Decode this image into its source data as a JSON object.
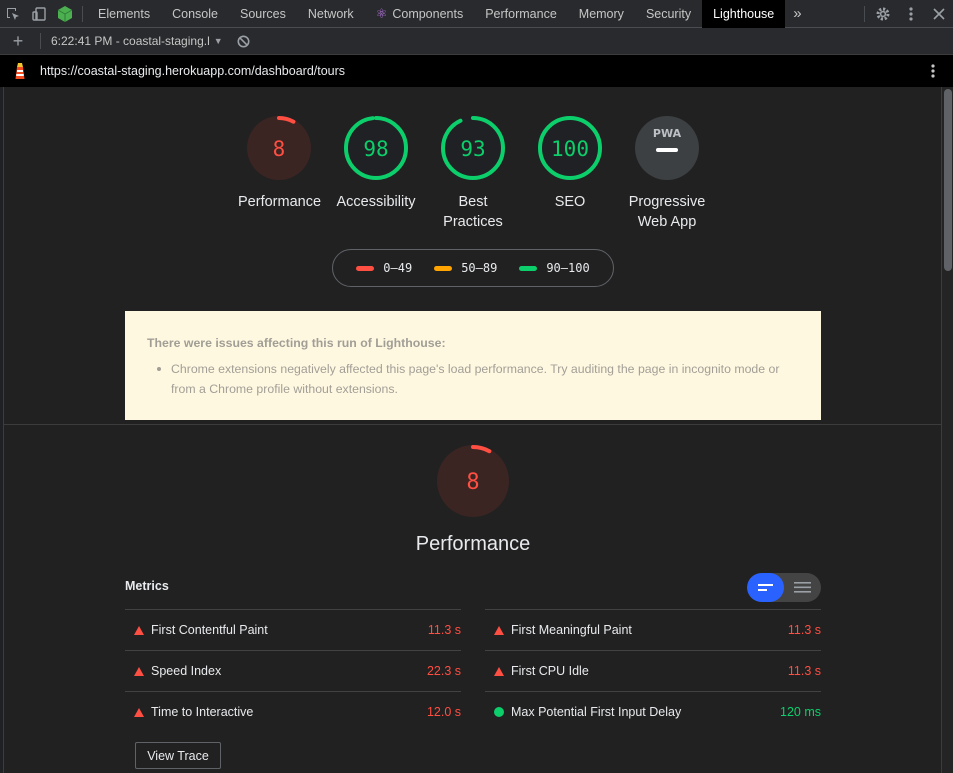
{
  "devtools": {
    "tabs": [
      {
        "label": "Elements"
      },
      {
        "label": "Console"
      },
      {
        "label": "Sources"
      },
      {
        "label": "Network"
      },
      {
        "label": "Components"
      },
      {
        "label": "Performance"
      },
      {
        "label": "Memory"
      },
      {
        "label": "Security"
      },
      {
        "label": "Lighthouse"
      }
    ],
    "active_tab": "Lighthouse",
    "more_tabs_label": "»"
  },
  "report_bar": {
    "add_label": "+",
    "report_select": "6:22:41 PM - coastal-staging.l",
    "url": "https://coastal-staging.herokuapp.com/dashboard/tours"
  },
  "categories": [
    {
      "label": "Performance",
      "score": "8",
      "fraction": 0.08,
      "color": "#ff4e42"
    },
    {
      "label": "Accessibility",
      "score": "98",
      "fraction": 0.98,
      "color": "#0cce6b"
    },
    {
      "label": "Best Practices",
      "score": "93",
      "fraction": 0.93,
      "color": "#0cce6b"
    },
    {
      "label": "SEO",
      "score": "100",
      "fraction": 1.0,
      "color": "#0cce6b"
    },
    {
      "label": "Progressive Web App",
      "score": "PWA",
      "fraction": 0,
      "color": "#9aa0a6"
    }
  ],
  "legend": [
    {
      "range": "0–49",
      "color": "#ff4e42"
    },
    {
      "range": "50–89",
      "color": "#ffa400"
    },
    {
      "range": "90–100",
      "color": "#0cce6b"
    }
  ],
  "warning": {
    "title": "There were issues affecting this run of Lighthouse:",
    "items": [
      "Chrome extensions negatively affected this page's load performance. Try auditing the page in incognito mode or from a Chrome profile without extensions."
    ]
  },
  "performance": {
    "score": "8",
    "fraction": 0.08,
    "title": "Performance",
    "metrics_label": "Metrics",
    "metrics_left": [
      {
        "name": "First Contentful Paint",
        "value": "11.3 s",
        "status": "fail"
      },
      {
        "name": "Speed Index",
        "value": "22.3 s",
        "status": "fail"
      },
      {
        "name": "Time to Interactive",
        "value": "12.0 s",
        "status": "fail"
      }
    ],
    "metrics_right": [
      {
        "name": "First Meaningful Paint",
        "value": "11.3 s",
        "status": "fail"
      },
      {
        "name": "First CPU Idle",
        "value": "11.3 s",
        "status": "fail"
      },
      {
        "name": "Max Potential First Input Delay",
        "value": "120 ms",
        "status": "pass"
      }
    ],
    "view_trace_label": "View Trace"
  },
  "colors": {
    "fail": "#ff4e42",
    "average": "#ffa400",
    "pass": "#0cce6b",
    "accent": "#2962ff"
  }
}
